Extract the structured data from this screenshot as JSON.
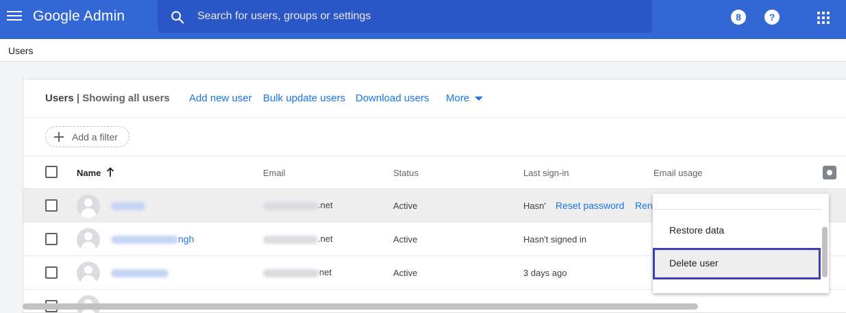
{
  "app": {
    "title": "Google Admin"
  },
  "search": {
    "placeholder": "Search for users, groups or settings"
  },
  "topbar": {
    "support_badge": "8",
    "help_glyph": "?"
  },
  "breadcrumb": {
    "label": "Users"
  },
  "card": {
    "title": "Users",
    "separator": " | ",
    "subtitle": "Showing all users",
    "actions": {
      "add_new_user": "Add new user",
      "bulk_update": "Bulk update users",
      "download": "Download users",
      "more": "More"
    }
  },
  "filter": {
    "add_label": "Add a filter"
  },
  "columns": {
    "name": "Name",
    "email": "Email",
    "status": "Status",
    "last_signin": "Last sign-in",
    "email_usage": "Email usage"
  },
  "rows": [
    {
      "name_visible": "",
      "email_suffix": ".net",
      "status": "Active",
      "last_signin": "Hasn'",
      "reset_password": "Reset password",
      "rename": "Rena"
    },
    {
      "name_visible": "ngh",
      "email_suffix": ".net",
      "status": "Active",
      "last_signin": "Hasn't signed in"
    },
    {
      "name_visible": "",
      "email_suffix": "net",
      "status": "Active",
      "last_signin": "3 days ago"
    }
  ],
  "dropdown": {
    "items": [
      "Restore data",
      "Delete user"
    ],
    "highlighted": "Delete user"
  },
  "colors": {
    "topbar": "#3367d6",
    "link": "#1a73e8",
    "highlight_border": "#3c3fb0"
  },
  "icons": [
    "menu-icon",
    "search-icon",
    "support-icon",
    "help-icon",
    "apps-grid-icon",
    "plus-icon",
    "sort-up-arrow-icon",
    "gear-icon",
    "avatar-icon"
  ]
}
